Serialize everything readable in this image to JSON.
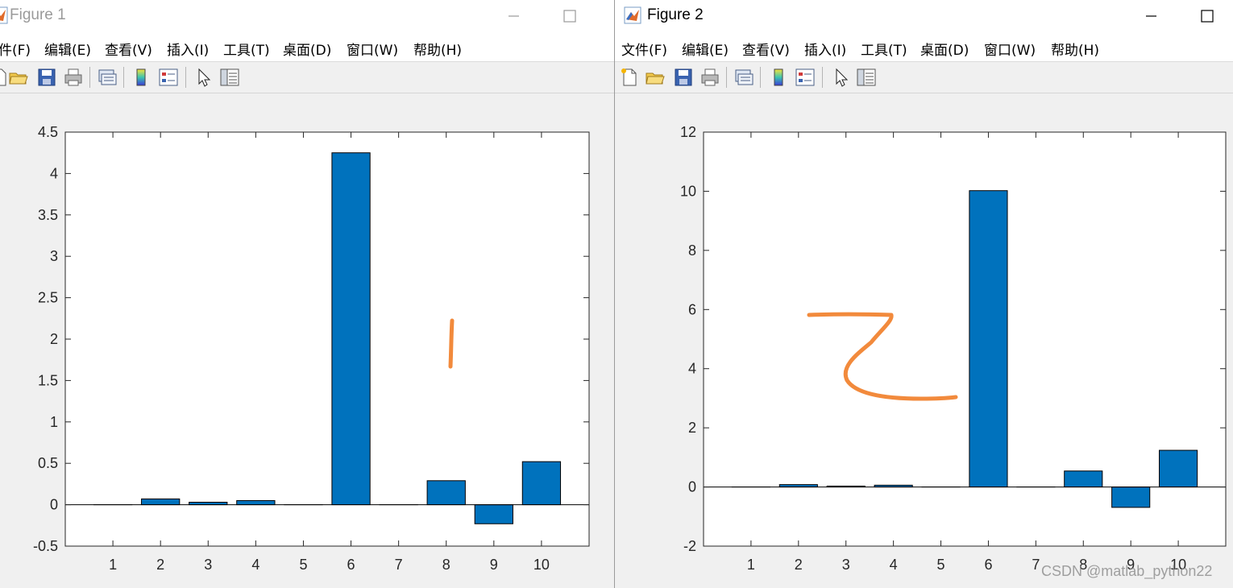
{
  "windows": [
    {
      "title": "Figure 1",
      "menu": [
        "件(F)",
        "编辑(E)",
        "查看(V)",
        "插入(I)",
        "工具(T)",
        "桌面(D)",
        "窗口(W)",
        "帮助(H)"
      ]
    },
    {
      "title": "Figure 2",
      "menu": [
        "文件(F)",
        "编辑(E)",
        "查看(V)",
        "插入(I)",
        "工具(T)",
        "桌面(D)",
        "窗口(W)",
        "帮助(H)"
      ]
    }
  ],
  "toolbar_icons": [
    "new-figure-icon",
    "open-folder-icon",
    "save-icon",
    "print-icon",
    "link-plot-icon",
    "colorbar-icon",
    "legend-icon",
    "pointer-icon",
    "property-editor-icon"
  ],
  "colors": {
    "bar": "#0072bd",
    "annotation": "#f28a3c",
    "title_inactive": "#9a9a9a"
  },
  "watermark": "CSDN @matlab_python22",
  "chart_data": [
    {
      "type": "bar",
      "categories": [
        "1",
        "2",
        "3",
        "4",
        "5",
        "6",
        "7",
        "8",
        "9",
        "10"
      ],
      "values": [
        0,
        0.07,
        0.03,
        0.05,
        0,
        4.25,
        0,
        0.29,
        -0.23,
        0.52
      ],
      "ylim": [
        -0.5,
        4.5
      ],
      "yticks": [
        "-0.5",
        "0",
        "0.5",
        "1",
        "1.5",
        "2",
        "2.5",
        "3",
        "3.5",
        "4",
        "4.5"
      ],
      "title": "",
      "xlabel": "",
      "ylabel": "",
      "annotation": "handwritten digit 1"
    },
    {
      "type": "bar",
      "categories": [
        "1",
        "2",
        "3",
        "4",
        "5",
        "6",
        "7",
        "8",
        "9",
        "10"
      ],
      "values": [
        0,
        0.08,
        0.03,
        0.06,
        0,
        10.02,
        0,
        0.54,
        -0.69,
        1.24
      ],
      "ylim": [
        -2,
        12
      ],
      "yticks": [
        "-2",
        "0",
        "2",
        "4",
        "6",
        "8",
        "10",
        "12"
      ],
      "title": "",
      "xlabel": "",
      "ylabel": "",
      "annotation": "handwritten character 乙"
    }
  ]
}
